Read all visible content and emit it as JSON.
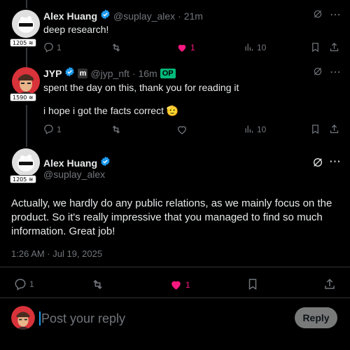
{
  "post1": {
    "name": "Alex Huang",
    "handle": "@suplay_alex",
    "time": "· 21m",
    "text": "deep research!",
    "badge": "1205 ≋",
    "replies": "1",
    "likes": "1",
    "views": "10"
  },
  "post2": {
    "name": "JYP",
    "handle": "@jyp_nft",
    "time": "· 16m",
    "op": "OP",
    "text1": "spent the day on this, thank you for reading it",
    "text2": "i hope i got the facts correct 🫡",
    "badge": "1590 ≋",
    "replies": "1",
    "views": "10"
  },
  "main": {
    "name": "Alex Huang",
    "handle": "@suplay_alex",
    "badge": "1205 ≋",
    "text": "Actually, we hardly do any public relations, as we mainly focus on the product. So it's really impressive that you managed to find so much information. Great job!",
    "timestamp": "1:26 AM · Jul 19, 2025",
    "replies": "1",
    "likes": "1"
  },
  "composer": {
    "placeholder": "Post your reply",
    "reply_label": "Reply"
  },
  "colors": {
    "like": "#f91880",
    "verified": "#1d9bf0",
    "op": "#00ba7c"
  }
}
